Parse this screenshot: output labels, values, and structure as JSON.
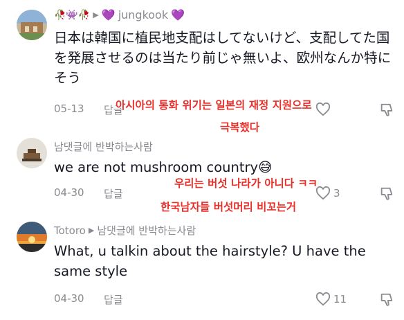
{
  "comments": [
    {
      "username": "jungkook",
      "username_prefix_emoji": "🥀👾🥀",
      "username_heart": "💜",
      "text": "日本は韓国に植民地支配はしてないけど、支配してた国を発展させるのは当たり前じゃ無いよ、欧州なんか特にそう",
      "date": "05-13",
      "reply_label": "답글",
      "like_count": "",
      "overlay": [
        "아시아의 통화 위기는 일본의 재정 지원으로",
        "극복했다"
      ]
    },
    {
      "username": "남댓글에 반박하는사람",
      "text": "we are not mushroom country",
      "text_emoji": "😅",
      "date": "04-30",
      "reply_label": "답글",
      "like_count": "3",
      "overlay": [
        "우리는 버섯 나라가 아니다 ㅋㅋ",
        "한국남자들 버섯머리 비꼬는거"
      ]
    },
    {
      "username": "Totoro",
      "reply_to": "남댓글에 반박하는사람",
      "text": "What, u talkin about the hairstyle? U have the same style",
      "date": "04-30",
      "reply_label": "답글",
      "like_count": "11"
    }
  ],
  "colors": {
    "overlay_red": "#e8302b",
    "meta_gray": "#8a8b91",
    "text": "#161823",
    "heart_purple": "#b57bee"
  },
  "icons": [
    "heart-outline-icon",
    "thumbs-down-icon",
    "play-arrow-icon"
  ]
}
